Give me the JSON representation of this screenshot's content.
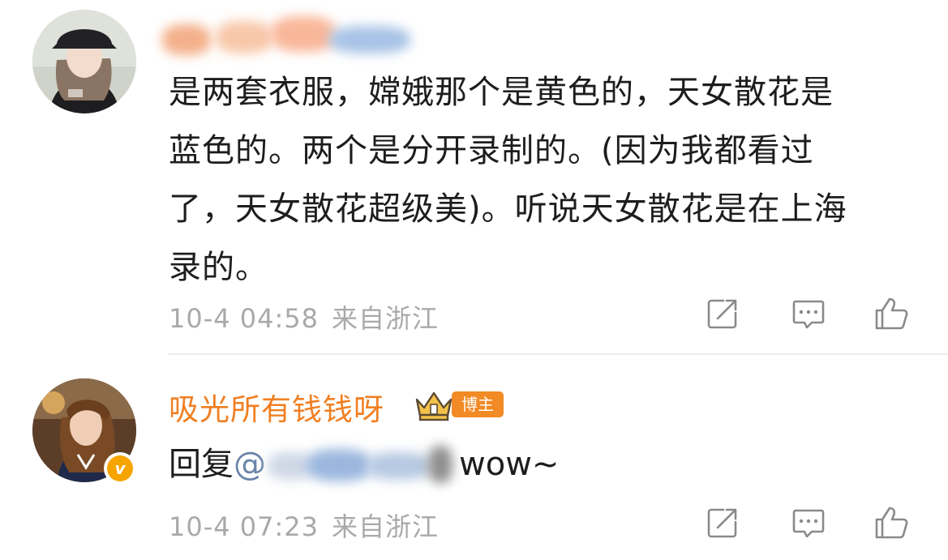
{
  "comments": [
    {
      "text_lines": [
        "是两套衣服，嫦娥那个是黄色的，天女散花是",
        "蓝色的。两个是分开录制的。(因为我都看过",
        "了，天女散花超级美)。听说天女散花是在上海",
        "录的。"
      ],
      "time": "10-4 04:58",
      "location": "来自浙江"
    },
    {
      "username": "吸光所有钱钱呀",
      "badge": "博主",
      "vip_mark": "v",
      "reply_prefix": "回复",
      "mention_at": "@",
      "reply_suffix": "wow~",
      "time": "10-4 07:23",
      "location": "来自浙江"
    }
  ],
  "colors": {
    "username": "#f07f22",
    "badge_bg": "#f28a25",
    "meta_text": "#a9a9a9",
    "icon": "#8a8a8a",
    "mention": "#6a84a8"
  },
  "icons": {
    "share": "share-icon",
    "reply": "comment-icon",
    "like": "thumbs-up-icon",
    "crown": "crown-icon"
  }
}
